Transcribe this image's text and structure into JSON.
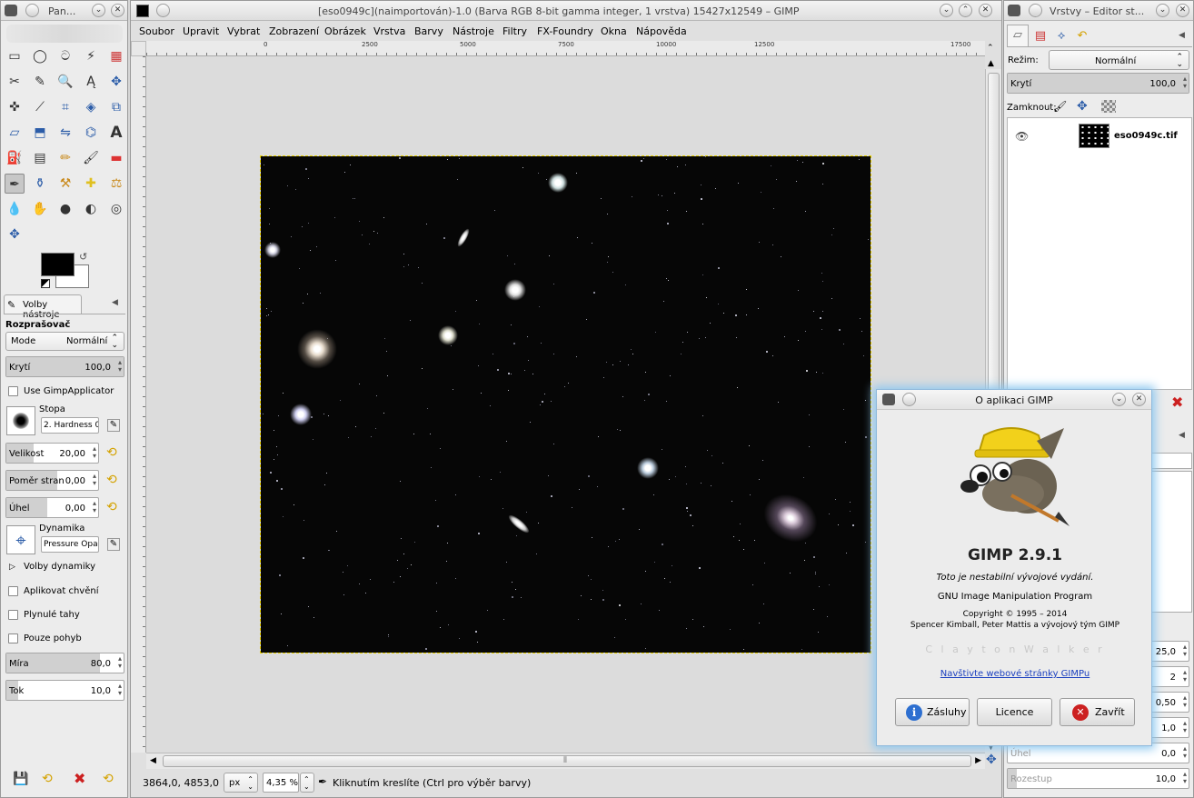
{
  "toolbox": {
    "title": "Pan...",
    "tool_options_tab": "Volby nástroje",
    "tool_name": "Rozprašovač",
    "mode_label": "Mode",
    "mode_value": "Normální",
    "opacity_label": "Krytí",
    "opacity_value": "100,0",
    "opacity_fraction": 1.0,
    "use_applicator": "Use GimpApplicator",
    "brush_label": "Stopa",
    "brush_value": "2. Hardness 0!",
    "size_label": "Velikost",
    "size_value": "20,00",
    "aspect_label": "Poměr stran",
    "aspect_value": "0,00",
    "angle_label": "Úhel",
    "angle_value": "0,00",
    "dynamics_label": "Dynamika",
    "dynamics_value": "Pressure Opac",
    "dynamics_options": "Volby dynamiky",
    "jitter": "Aplikovat chvění",
    "smooth": "Plynulé tahy",
    "incremental": "Pouze pohyb",
    "rate_label": "Míra",
    "rate_value": "80,0",
    "rate_fraction": 0.8,
    "flow_label": "Tok",
    "flow_value": "10,0",
    "flow_fraction": 0.1
  },
  "image_window": {
    "title": "[eso0949c](naimportován)-1.0 (Barva RGB 8-bit gamma integer, 1 vrstva) 15427x12549 – GIMP",
    "menu": [
      "Soubor",
      "Upravit",
      "Vybrat",
      "Zobrazení",
      "Obrázek",
      "Vrstva",
      "Barvy",
      "Nástroje",
      "Filtry",
      "FX-Foundry",
      "Okna",
      "Nápověda"
    ],
    "ruler_labels": [
      "0",
      "2500",
      "5000",
      "7500",
      "10000",
      "12500",
      "17500"
    ],
    "coords": "3864,0, 4853,0",
    "unit": "px",
    "zoom": "4,35 %",
    "status": "Kliknutím kreslíte (Ctrl pro výběr barvy)"
  },
  "layers": {
    "title": "Vrstvy – Editor st...",
    "mode_label": "Režim:",
    "mode_value": "Normální",
    "opacity_label": "Krytí",
    "opacity_value": "100,0",
    "lock_label": "Zamknout:",
    "layer_name": "eso0949c.tif",
    "values": [
      "25,0",
      "2",
      "0,50",
      "1,0",
      "0,0",
      "10,0"
    ],
    "angle_label": "Úhel",
    "spacing_label": "Rozestup"
  },
  "about": {
    "title": "O aplikaci GIMP",
    "version": "GIMP 2.9.1",
    "unstable": "Toto je nestabilní vývojové vydání.",
    "program": "GNU Image Manipulation Program",
    "copyright": "Copyright © 1995 – 2014",
    "authors": "Spencer Kimball, Peter Mattis a vývojový tým GIMP",
    "credits_name": "C l a y t o n   W a l k e r",
    "link": "Navštivte webové stránky GIMPu",
    "btn_credits": "Zásluhy",
    "btn_license": "Licence",
    "btn_close": "Zavřít"
  },
  "colors": {
    "fg": "#000000",
    "bg": "#ffffff",
    "link": "#1a3fbf",
    "close_red": "#cc2020",
    "info_blue": "#2d6fd0"
  }
}
